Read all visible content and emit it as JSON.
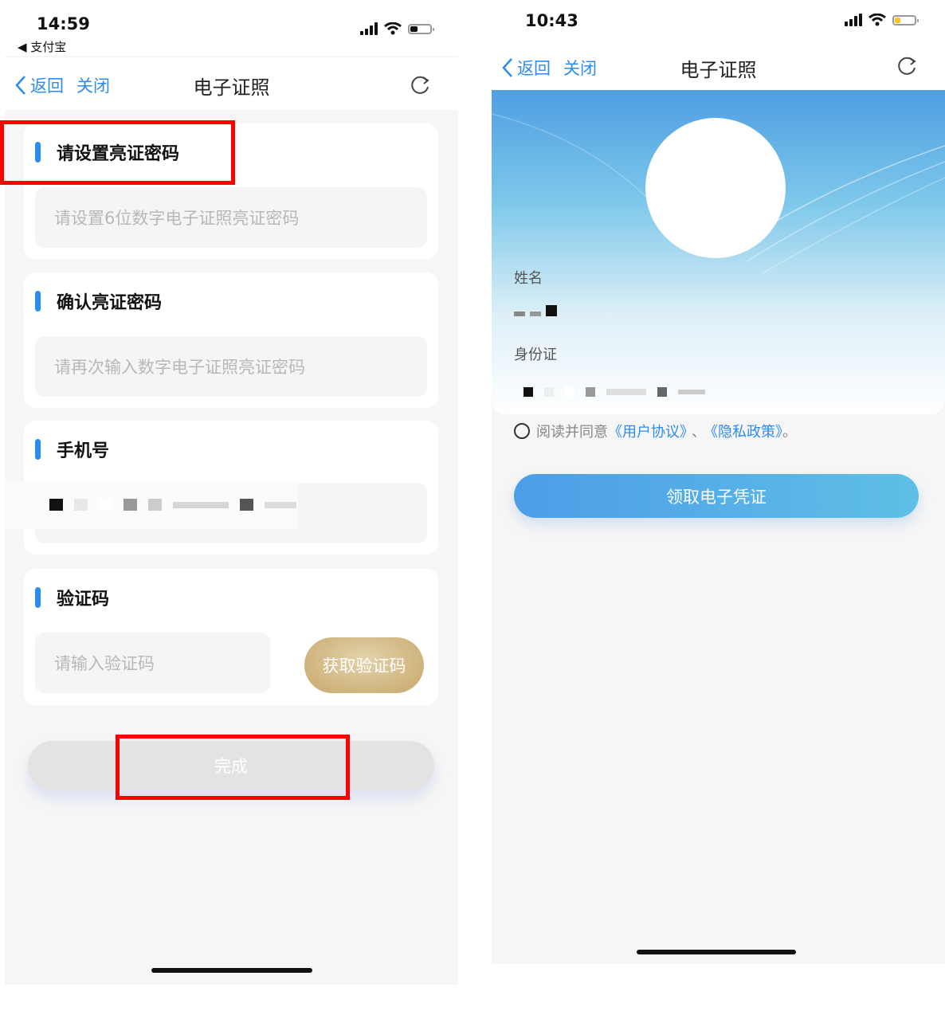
{
  "left": {
    "status": {
      "time": "14:59",
      "back_app": "◀ 支付宝"
    },
    "nav": {
      "back": "返回",
      "close": "关闭",
      "title": "电子证照"
    },
    "sections": {
      "set_password": {
        "title": "请设置亮证密码",
        "placeholder": "请设置6位数字电子证照亮证密码"
      },
      "confirm_password": {
        "title": "确认亮证密码",
        "placeholder": "请再次输入数字电子证照亮证密码"
      },
      "phone": {
        "title": "手机号"
      },
      "code": {
        "title": "验证码",
        "placeholder": "请输入验证码",
        "button": "获取验证码"
      }
    },
    "done_button": "完成"
  },
  "right": {
    "status": {
      "time": "10:43"
    },
    "nav": {
      "back": "返回",
      "close": "关闭",
      "title": "电子证照"
    },
    "fields": {
      "name_label": "姓名",
      "id_label": "身份证"
    },
    "agreement": {
      "prefix": "阅读并同意",
      "user_agreement": "《用户协议》",
      "separator": "、",
      "privacy_policy": "《隐私政策》",
      "suffix": "。"
    },
    "claim_button": "领取电子凭证"
  },
  "colors": {
    "accent": "#2b8cf0",
    "highlight": "#ff0000",
    "gold": "#cfb47d"
  },
  "icons": [
    "chevron-left-icon",
    "refresh-icon",
    "signal-icon",
    "wifi-icon",
    "battery-icon"
  ]
}
